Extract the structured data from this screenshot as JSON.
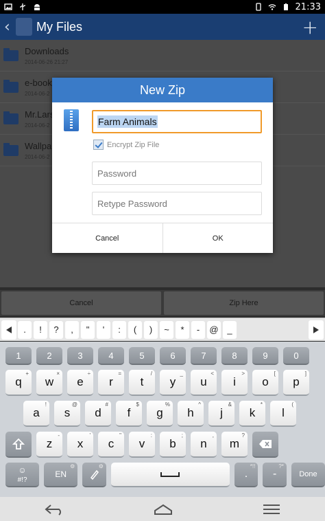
{
  "status_bar": {
    "time": "21:33",
    "left_icons": [
      "image-icon",
      "usb-icon",
      "android-icon"
    ],
    "right_icons": [
      "vibrate-icon",
      "wifi-icon",
      "battery-icon"
    ]
  },
  "app_bar": {
    "title": "My Files",
    "back_icon": "chevron-left-icon",
    "add_icon": "plus-icon"
  },
  "files": [
    {
      "name": "Downloads",
      "date": "2014-06-26 21:27"
    },
    {
      "name": "e-book",
      "date": "2014-06-2"
    },
    {
      "name": "Mr.Lars",
      "date": "2014-06-2"
    },
    {
      "name": "Wallpa",
      "date": "2014-06-2"
    }
  ],
  "actions": {
    "cancel": "Cancel",
    "zip_here": "Zip Here"
  },
  "dialog": {
    "title": "New Zip",
    "name_value": "Farm Animals",
    "encrypt_label": "Encrypt Zip File",
    "encrypt_checked": true,
    "password_placeholder": "Password",
    "retype_placeholder": "Retype Password",
    "cancel": "Cancel",
    "ok": "OK",
    "accent": "#3a7bc8",
    "focus_color": "#f09a2a"
  },
  "symbol_bar": {
    "keys": [
      ".",
      "!",
      "?",
      ",",
      "\"",
      "'",
      ":",
      "(",
      ")",
      "~",
      "*",
      "-",
      "@",
      "_"
    ]
  },
  "keyboard": {
    "numbers": [
      "1",
      "2",
      "3",
      "4",
      "5",
      "6",
      "7",
      "8",
      "9",
      "0"
    ],
    "row1": [
      {
        "k": "q",
        "a": "+"
      },
      {
        "k": "w",
        "a": "×"
      },
      {
        "k": "e",
        "a": "÷"
      },
      {
        "k": "r",
        "a": "="
      },
      {
        "k": "t",
        "a": "/"
      },
      {
        "k": "y",
        "a": "_"
      },
      {
        "k": "u",
        "a": "<"
      },
      {
        "k": "i",
        "a": ">"
      },
      {
        "k": "o",
        "a": "["
      },
      {
        "k": "p",
        "a": "]"
      }
    ],
    "row2": [
      {
        "k": "a",
        "a": "!"
      },
      {
        "k": "s",
        "a": "@"
      },
      {
        "k": "d",
        "a": "#"
      },
      {
        "k": "f",
        "a": "$"
      },
      {
        "k": "g",
        "a": "%"
      },
      {
        "k": "h",
        "a": "^"
      },
      {
        "k": "j",
        "a": "&"
      },
      {
        "k": "k",
        "a": "*"
      },
      {
        "k": "l",
        "a": "("
      }
    ],
    "row3": [
      {
        "k": "z",
        "a": "-"
      },
      {
        "k": "x",
        "a": "'"
      },
      {
        "k": "c",
        "a": "\""
      },
      {
        "k": "v",
        "a": ":"
      },
      {
        "k": "b",
        "a": ";"
      },
      {
        "k": "n",
        "a": ","
      },
      {
        "k": "m",
        "a": "?"
      }
    ],
    "symbols_key": "#!?",
    "lang_key": "EN",
    "done_key": "Done",
    "dot_key": ".",
    "dash_key": "-"
  },
  "nav_bar": {
    "icons": [
      "back-icon",
      "home-icon",
      "menu-icon"
    ]
  }
}
